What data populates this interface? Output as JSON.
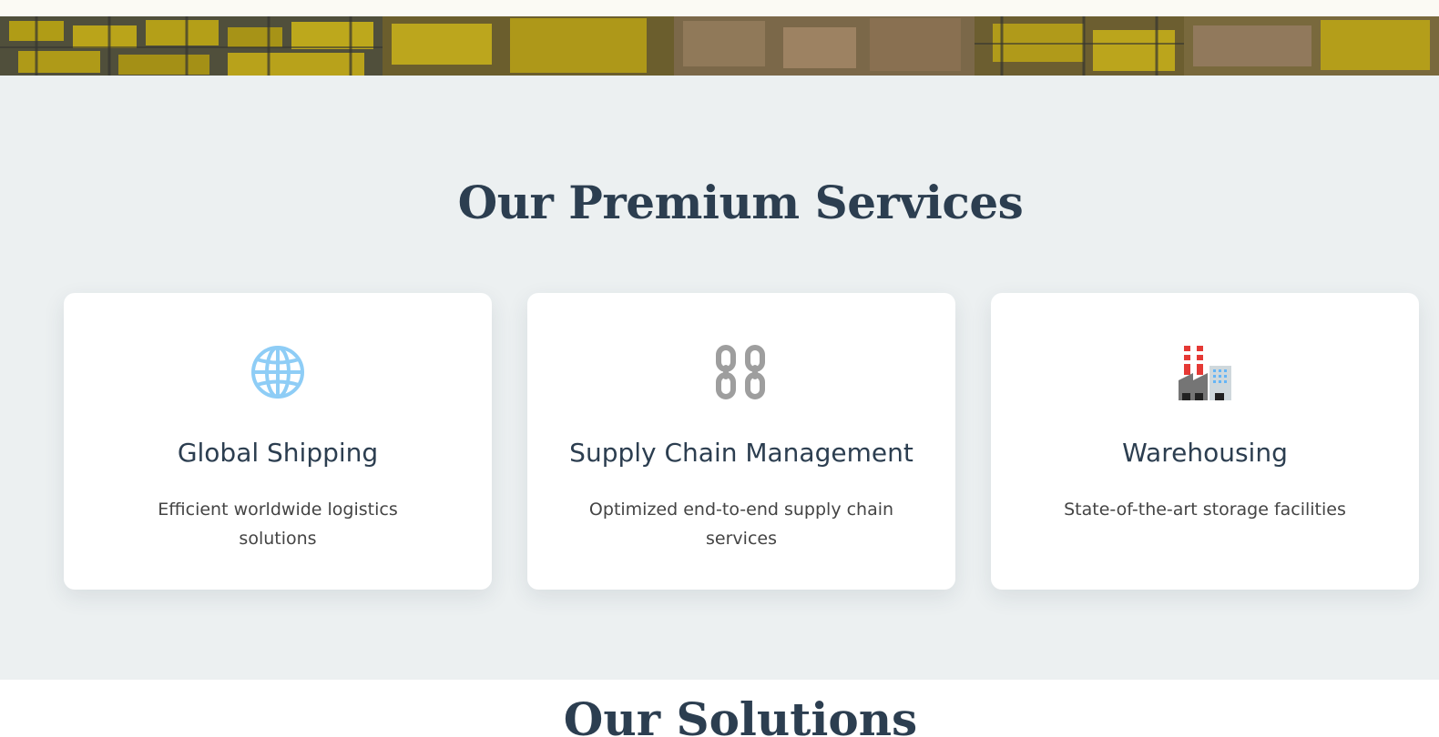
{
  "hero": {
    "image": "warehouse-shelves-photo"
  },
  "services": {
    "title": "Our Premium Services",
    "cards": [
      {
        "icon": "globe-icon",
        "title": "Global Shipping",
        "description": "Efficient worldwide logistics solutions"
      },
      {
        "icon": "chain-icon",
        "title": "Supply Chain Management",
        "description": "Optimized end-to-end supply chain services"
      },
      {
        "icon": "factory-icon",
        "title": "Warehousing",
        "description": "State-of-the-art storage facilities"
      }
    ]
  },
  "solutions": {
    "title": "Our Solutions"
  },
  "colors": {
    "heading": "#2c3e50",
    "section_background": "#ecf0f1",
    "card_background": "#ffffff",
    "body_text": "#444444",
    "globe": "#8ecdf6",
    "chain": "#9e9e9e",
    "factory_chimney": "#e53935"
  }
}
